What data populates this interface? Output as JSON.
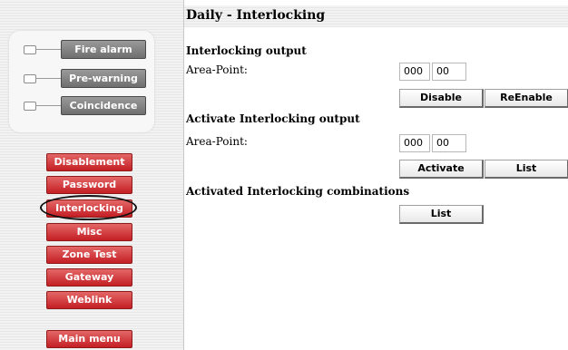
{
  "sidebar": {
    "status_indicators": [
      {
        "label": "Fire alarm"
      },
      {
        "label": "Pre-warning"
      },
      {
        "label": "Coincidence"
      }
    ],
    "menu": [
      {
        "label": "Disablement"
      },
      {
        "label": "Password"
      },
      {
        "label": "Interlocking",
        "selected": true
      },
      {
        "label": "Misc"
      },
      {
        "label": "Zone Test"
      },
      {
        "label": "Gateway"
      },
      {
        "label": "Weblink"
      }
    ],
    "main_menu_label": "Main menu"
  },
  "page": {
    "title": "Daily - Interlocking",
    "interlocking_output": {
      "heading": "Interlocking output",
      "field_label": "Area-Point:",
      "area": "000",
      "point": "00",
      "disable_label": "Disable",
      "reenable_label": "ReEnable"
    },
    "activate_output": {
      "heading": "Activate Interlocking output",
      "field_label": "Area-Point:",
      "area": "000",
      "point": "00",
      "activate_label": "Activate",
      "list_label": "List"
    },
    "activated_combinations": {
      "heading": "Activated Interlocking combinations",
      "list_label": "List"
    }
  }
}
